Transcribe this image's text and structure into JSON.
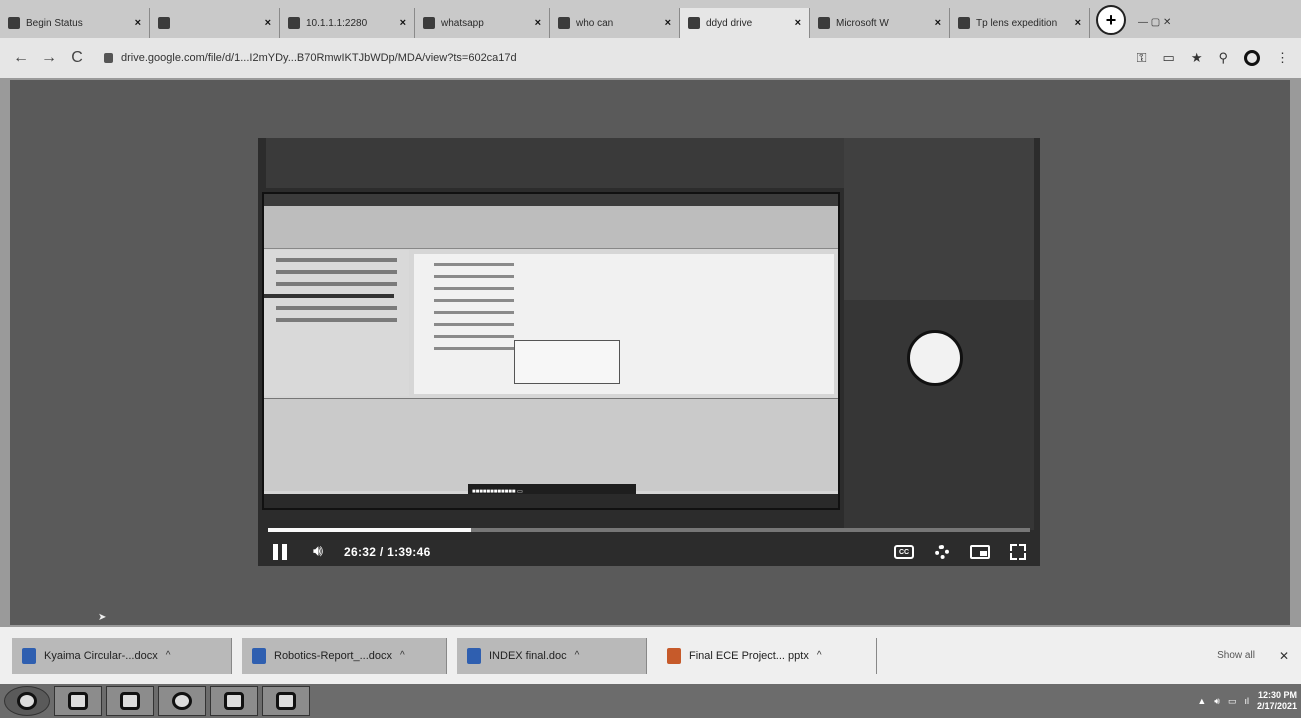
{
  "browser": {
    "tabs": [
      {
        "title": "Begin Status",
        "active": false
      },
      {
        "title": "",
        "active": false
      },
      {
        "title": "10.1.1.1:2280",
        "active": false
      },
      {
        "title": "whatsapp ",
        "active": false
      },
      {
        "title": "who can",
        "active": false
      },
      {
        "title": "ddyd drive",
        "active": true
      },
      {
        "title": "Microsoft W",
        "active": false
      },
      {
        "title": "Tp lens expedition",
        "active": false
      }
    ],
    "new_tab_label": "+",
    "address": "drive.google.com/file/d/1...I2mYDy...B70RmwIKTJbWDp/MDA/view?ts=602ca17d"
  },
  "player": {
    "elapsed": "26:32",
    "duration": "1:39:46",
    "time_display": "26:32 / 1:39:46",
    "progress_fraction": 0.266,
    "cc_label": "CC"
  },
  "downloads": {
    "items": [
      {
        "name": "Kyaima Circular-...docx"
      },
      {
        "name": "Robotics-Report_...docx"
      },
      {
        "name": "INDEX final.doc"
      },
      {
        "name": "Final ECE Project... pptx"
      }
    ],
    "show_all": "Show all"
  },
  "taskbar": {
    "time": "12:30 PM",
    "date": "2/17/2021"
  }
}
